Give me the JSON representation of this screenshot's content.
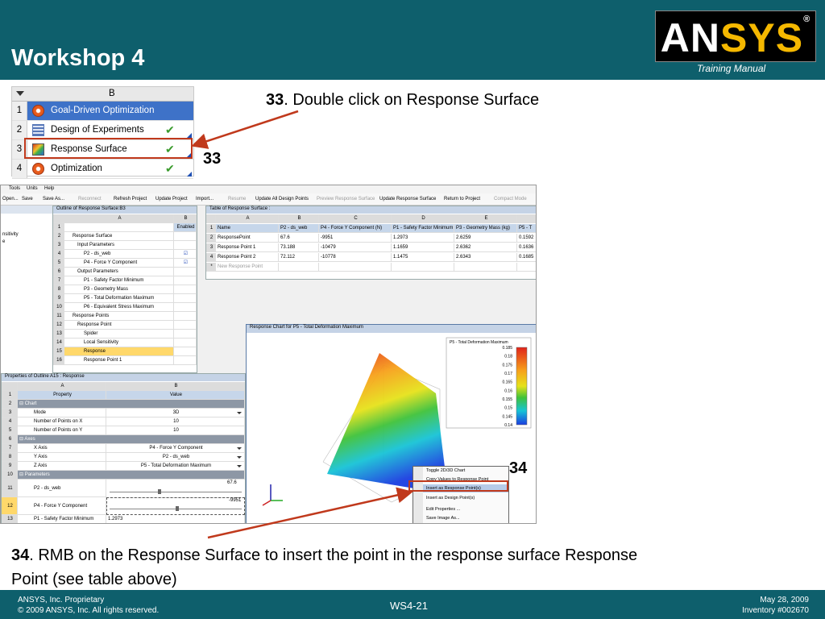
{
  "header": {
    "title": "Workshop 4",
    "logo_text_a": "AN",
    "logo_text_b": "SYS",
    "logo_reg": "®",
    "subtitle": "Training Manual"
  },
  "schematic": {
    "column": "B",
    "rows": [
      {
        "num": "1",
        "label": "Goal-Driven Optimization",
        "icon": "goal-driven-icon"
      },
      {
        "num": "2",
        "label": "Design of Experiments",
        "icon": "doe-icon"
      },
      {
        "num": "3",
        "label": "Response Surface",
        "icon": "response-surface-icon"
      },
      {
        "num": "4",
        "label": "Optimization",
        "icon": "optimization-icon"
      }
    ]
  },
  "step33": {
    "num": "33",
    "text": ". Double click on Response Surface",
    "callout": "33"
  },
  "step34": {
    "num": "34",
    "text": ". RMB on the Response Surface to insert the point in the response surface Response Point (see table above)",
    "callout": "34"
  },
  "app": {
    "menu": [
      "Tools",
      "Units",
      "Help"
    ],
    "toolbar": [
      "Open...",
      "Save",
      "Save As...",
      "Reconnect",
      "Refresh Project",
      "Update Project",
      "Import...",
      "Resume",
      "Update All Design Points",
      "Preview Response Surface",
      "Update Response Surface",
      "Return to Project",
      "Compact Mode"
    ],
    "outline": {
      "title": "Outline of Response Surface:B3",
      "col_a": "A",
      "col_b": "B",
      "enabled": "Enabled",
      "rows": [
        {
          "n": "1",
          "label": ""
        },
        {
          "n": "2",
          "label": "Response Surface"
        },
        {
          "n": "3",
          "label": "Input Parameters"
        },
        {
          "n": "4",
          "label": "P2 - ds_web"
        },
        {
          "n": "5",
          "label": "P4 - Force Y Component"
        },
        {
          "n": "6",
          "label": "Output Parameters"
        },
        {
          "n": "7",
          "label": "P1 - Safety Factor Minimum"
        },
        {
          "n": "8",
          "label": "P3 - Geometry Mass"
        },
        {
          "n": "9",
          "label": "P5 - Total Deformation Maximum"
        },
        {
          "n": "10",
          "label": "P6 - Equivalent Stress Maximum"
        },
        {
          "n": "11",
          "label": "Response Points"
        },
        {
          "n": "12",
          "label": "Response Point"
        },
        {
          "n": "13",
          "label": "Spider"
        },
        {
          "n": "14",
          "label": "Local Sensitivity"
        },
        {
          "n": "15",
          "label": "Response"
        },
        {
          "n": "16",
          "label": "Response Point 1"
        }
      ]
    },
    "left_panel_items": [
      "nsitivity",
      "e"
    ],
    "table": {
      "title": "Table of Response Surface :",
      "cols": [
        "A",
        "B",
        "C",
        "D",
        "E"
      ],
      "headers": [
        "Name",
        "P2 - ds_web",
        "P4 - Force Y Component (N)",
        "P1 - Safety Factor Minimum",
        "P3 - Geometry Mass (kg)",
        "P5 - T"
      ],
      "rows": [
        {
          "n": "2",
          "cells": [
            "ResponsePoint",
            "67.6",
            "-9951",
            "1.2973",
            "2.6259",
            "0.1592"
          ]
        },
        {
          "n": "3",
          "cells": [
            "Response Point 1",
            "73.188",
            "-10479",
            "1.1659",
            "2.6362",
            "0.1636"
          ]
        },
        {
          "n": "4",
          "cells": [
            "Response Point 2",
            "72.112",
            "-10778",
            "1.1475",
            "2.6343",
            "0.1685"
          ]
        },
        {
          "n": "*",
          "cells": [
            "New Response Point",
            "",
            "",
            "",
            "",
            ""
          ]
        }
      ]
    },
    "properties": {
      "title": "Properties of Outline A15 : Response",
      "col_a": "A",
      "col_b": "B",
      "h_property": "Property",
      "h_value": "Value",
      "rows": [
        {
          "n": "2",
          "label": "Chart",
          "value": "",
          "section": true
        },
        {
          "n": "3",
          "label": "Mode",
          "value": "3D",
          "dd": true
        },
        {
          "n": "4",
          "label": "Number of Points on X",
          "value": "10"
        },
        {
          "n": "5",
          "label": "Number of Points on Y",
          "value": "10"
        },
        {
          "n": "6",
          "label": "Axes",
          "value": "",
          "section": true
        },
        {
          "n": "7",
          "label": "X Axis",
          "value": "P4 - Force Y Component",
          "dd": true
        },
        {
          "n": "8",
          "label": "Y Axis",
          "value": "P2 - ds_web",
          "dd": true
        },
        {
          "n": "9",
          "label": "Z Axis",
          "value": "P5 - Total Deformation Maximum",
          "dd": true
        },
        {
          "n": "10",
          "label": "Parameters",
          "value": "",
          "section": true
        }
      ],
      "p11_label": "P2 - ds_web",
      "p11_value": "67.6",
      "p12_label": "P4 - Force Y Component",
      "p12_value": "-9951",
      "p13_label": "P1 - Safety Factor Minimum",
      "p13_value": "1.2973"
    },
    "chart": {
      "title": "Response Chart for P5 - Total Deformation Maximum",
      "legend_title": "P5 - Total Deformation Maximum",
      "legend_values": [
        "0.185",
        "0.18",
        "0.175",
        "0.17",
        "0.165",
        "0.16",
        "0.155",
        "0.15",
        "0.145",
        "0.14"
      ]
    },
    "context_menu": [
      "Toggle 2D/3D Chart",
      "Copy Values to Response Point",
      "Insert as Response Point(s)",
      "Insert as Design Point(s)",
      "Edit Properties ...",
      "Save Image As..."
    ]
  },
  "footer": {
    "left1": "ANSYS, Inc. Proprietary",
    "left2": "© 2009 ANSYS, Inc.  All rights reserved.",
    "center": "WS4-21",
    "right1": "May 28, 2009",
    "right2": "Inventory #002670"
  },
  "colors": {
    "header_bg": "#0e5f6c",
    "logo_yellow": "#f5b800",
    "annotation_red": "#c0391c",
    "selection_blue": "#3e72c8"
  }
}
